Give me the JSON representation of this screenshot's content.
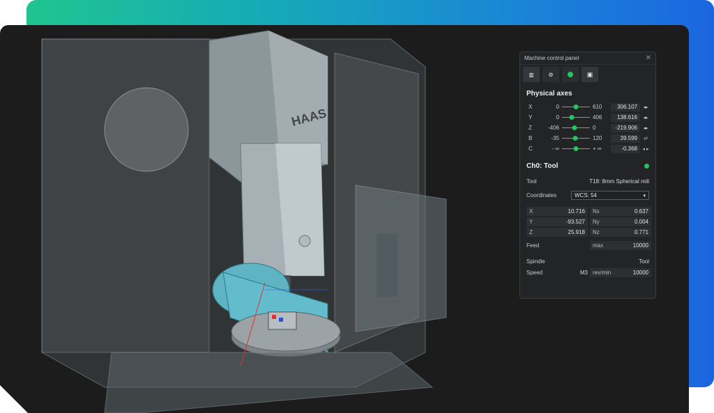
{
  "panel": {
    "title": "Machine control panel",
    "close_icon": "close-icon",
    "toolbar": [
      {
        "icon": "columns-icon",
        "glyph": "▥"
      },
      {
        "icon": "sliders-icon",
        "glyph": "⚙"
      },
      {
        "icon": "status-dot-icon",
        "glyph": "●"
      },
      {
        "icon": "save-icon",
        "glyph": "💾"
      }
    ],
    "physical_axes_title": "Physical axes",
    "axes": [
      {
        "name": "X",
        "min": "0",
        "max": "610",
        "value": "306.107",
        "level": 0.5,
        "control": "◂▸"
      },
      {
        "name": "Y",
        "min": "0",
        "max": "406",
        "value": "138.616",
        "level": 0.34,
        "control": "◂▸"
      },
      {
        "name": "Z",
        "min": "-406",
        "max": "0",
        "value": "-219.906",
        "level": 0.46,
        "control": "◂▸"
      },
      {
        "name": "B",
        "min": "-35",
        "max": "120",
        "value": "39.599",
        "level": 0.48,
        "control": "⇄"
      },
      {
        "name": "C",
        "min": "- ∞",
        "max": "+ ∞",
        "value": "-0.368",
        "level": 0.5,
        "control": "◂ ▸"
      }
    ],
    "channel_title": "Ch0: Tool",
    "tool_label": "Tool",
    "tool_value": "T18: 8mm Spherical mill",
    "coordinates_label": "Coordinates",
    "coordinates_value": "WCS: 54",
    "coords": [
      {
        "label": "X",
        "value": "10.716"
      },
      {
        "label": "Nx",
        "value": "0.637"
      },
      {
        "label": "Y",
        "value": "-93.527"
      },
      {
        "label": "Ny",
        "value": "0.004"
      },
      {
        "label": "Z",
        "value": "25.918"
      },
      {
        "label": "Nz",
        "value": "0.771"
      }
    ],
    "feed_label": "Feed",
    "feed_unit": "max",
    "feed_value": "10000",
    "spindle_label": "Spindle",
    "spindle_source": "Tool",
    "speed_label": "Speed",
    "speed_mode": "M3",
    "speed_unit": "rev/min",
    "speed_value": "10000"
  },
  "colors": {
    "accent": "#22c55e",
    "gradient_start": "#1fc490",
    "gradient_end": "#1b66e0",
    "viewport_bg": "#1c1c1c"
  }
}
